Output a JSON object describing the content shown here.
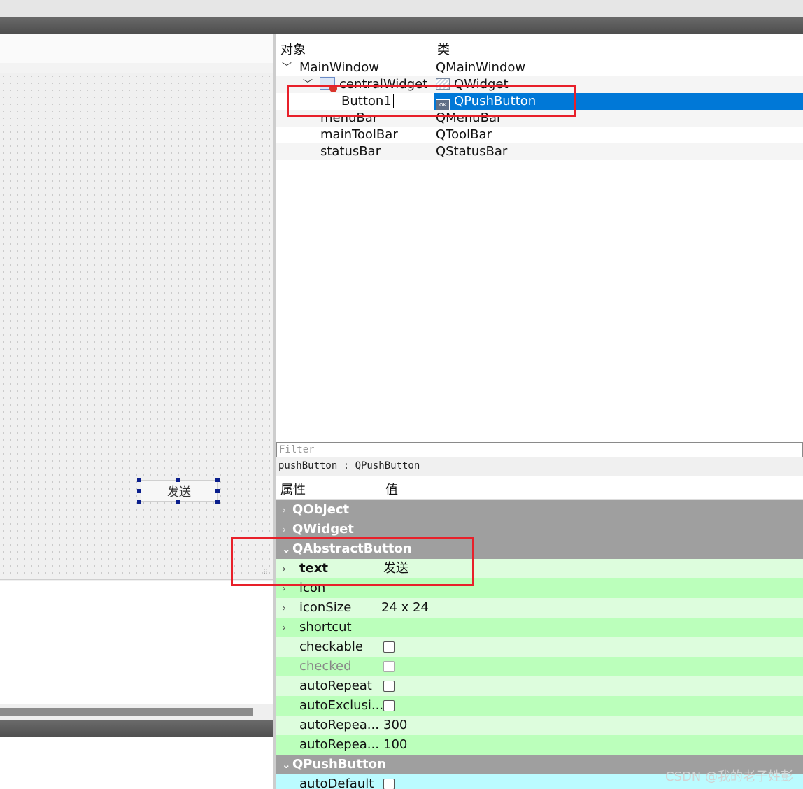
{
  "object_inspector": {
    "col_object": "对象",
    "col_class": "类",
    "rows": [
      {
        "name": "MainWindow",
        "class": "QMainWindow"
      },
      {
        "name": "centralWidget",
        "class": "QWidget"
      },
      {
        "name": "Button1",
        "class": "QPushButton"
      },
      {
        "name": "menuBar",
        "class": "QMenuBar"
      },
      {
        "name": "mainToolBar",
        "class": "QToolBar"
      },
      {
        "name": "statusBar",
        "class": "QStatusBar"
      }
    ]
  },
  "form": {
    "button_text": "发送"
  },
  "property_editor": {
    "filter_placeholder": "Filter",
    "object_info": "pushButton : QPushButton",
    "col_property": "属性",
    "col_value": "值",
    "rows": [
      {
        "name": "QObject",
        "value": ""
      },
      {
        "name": "QWidget",
        "value": ""
      },
      {
        "name": "QAbstractButton",
        "value": ""
      },
      {
        "name": "text",
        "value": "发送"
      },
      {
        "name": "icon",
        "value": ""
      },
      {
        "name": "iconSize",
        "value": "24 x 24"
      },
      {
        "name": "shortcut",
        "value": ""
      },
      {
        "name": "checkable",
        "value": ""
      },
      {
        "name": "checked",
        "value": ""
      },
      {
        "name": "autoRepeat",
        "value": ""
      },
      {
        "name": "autoExclusi...",
        "value": ""
      },
      {
        "name": "autoRepea...",
        "value": "300"
      },
      {
        "name": "autoRepea...",
        "value": "100"
      },
      {
        "name": "QPushButton",
        "value": ""
      },
      {
        "name": "autoDefault",
        "value": ""
      }
    ]
  },
  "watermark": "CSDN @我的老子姓彭",
  "colors": {
    "selection": "#0078d7",
    "highlight_box": "#e8202a",
    "category_bg": "#9f9f9f",
    "prop_green": "#bbffbb",
    "prop_cyan": "#bbfbff"
  }
}
